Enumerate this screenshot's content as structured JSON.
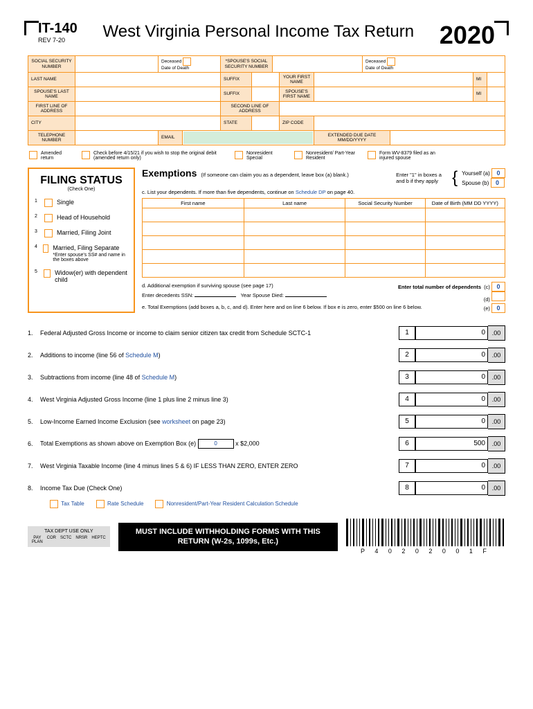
{
  "header": {
    "form_id": "IT-140",
    "rev": "REV 7-20",
    "title": "West Virginia Personal Income Tax Return",
    "year": "2020"
  },
  "grid": {
    "ssn": "SOCIAL SECURITY NUMBER",
    "deceased": "Deceased",
    "dod": "Date of Death",
    "spouse_ssn": "*SPOUSE'S SOCIAL SECURITY NUMBER",
    "last": "LAST NAME",
    "suffix": "SUFFIX",
    "first": "YOUR FIRST NAME",
    "mi": "MI",
    "spouse_last": "SPOUSE'S LAST NAME",
    "spouse_first": "SPOUSE'S FIRST NAME",
    "addr1": "FIRST LINE OF ADDRESS",
    "addr2": "SECOND LINE OF ADDRESS",
    "city": "CITY",
    "state": "STATE",
    "zip": "ZIP CODE",
    "phone": "TELEPHONE NUMBER",
    "email": "EMAIL",
    "ext_due": "EXTENDED DUE DATE MM/DD/YYYY"
  },
  "checks": {
    "amended": "Amended return",
    "stop_debit": "Check before 4/15/21 if you wish to stop the original debit (amended return only)",
    "nonres": "Nonresident Special",
    "partyear": "Nonresident/ Part-Year Resident",
    "wv8379": "Form WV-8379 filed as an injured spouse"
  },
  "filing": {
    "title": "FILING STATUS",
    "sub": "(Check One)",
    "opts": [
      "Single",
      "Head of Household",
      "Married, Filing Joint",
      "Married, Filing Separate",
      "Widow(er) with dependent child"
    ],
    "note": "*Enter spouse's SS# and name in the boxes above"
  },
  "exemptions": {
    "title": "Exemptions",
    "sub": "(If someone can claim you as a dependent, leave box (a) blank.)",
    "enter1": "Enter \"1\" in boxes a and b if they apply",
    "yourself": "Yourself (a)",
    "spouse": "Spouse (b)",
    "val_a": "0",
    "val_b": "0",
    "list": "c. List your dependents. If more than five dependents, continue on",
    "schedule_dp": "Schedule DP",
    "list2": "on page 40.",
    "cols": [
      "First name",
      "Last name",
      "Social Security Number",
      "Date of Birth (MM DD YYYY)"
    ],
    "d": "d. Additional exemption if surviving spouse (see page 17)",
    "d2": "Enter decedents SSN:",
    "d3": "Year Spouse Died:",
    "total_dep": "Enter total number of dependents",
    "val_c": "0",
    "val_d": "",
    "e": "e. Total Exemptions (add boxes a, b, c, and d). Enter here and on line 6 below. If box e is zero, enter $500 on line 6 below.",
    "val_e": "0"
  },
  "lines": [
    {
      "n": "1.",
      "t": "Federal Adjusted Gross Income or income to claim senior citizen tax credit from Schedule SCTC-1",
      "box": "1",
      "amt": "0"
    },
    {
      "n": "2.",
      "t": "Additions to income (line 56 of ",
      "link": "Schedule M",
      "t2": ")",
      "box": "2",
      "amt": "0"
    },
    {
      "n": "3.",
      "t": "Subtractions from income (line 48 of ",
      "link": "Schedule M",
      "t2": ")",
      "box": "3",
      "amt": "0"
    },
    {
      "n": "4.",
      "t": "West Virginia Adjusted Gross Income (line 1 plus line 2 minus line 3)",
      "box": "4",
      "amt": "0"
    },
    {
      "n": "5.",
      "t": "Low-Income Earned Income Exclusion (see ",
      "link": "worksheet",
      "t2": " on page 23)",
      "box": "5",
      "amt": "0"
    },
    {
      "n": "6.",
      "t": "Total Exemptions as shown above on Exemption Box (e) ",
      "inline": "0",
      "t2": " x $2,000 ",
      "box": "6",
      "amt": "500"
    },
    {
      "n": "7.",
      "t": "West Virginia Taxable Income (line 4 minus lines 5 & 6) IF LESS THAN ZERO, ENTER ZERO ",
      "box": "7",
      "amt": "0"
    },
    {
      "n": "8.",
      "t": "Income Tax Due (Check One) ",
      "box": "8",
      "amt": "0"
    }
  ],
  "line8_opts": [
    "Tax Table",
    "Rate Schedule",
    "Nonresident/Part-Year Resident Calculation Schedule"
  ],
  "footer": {
    "tax_dept": "TAX DEPT USE ONLY",
    "cols": [
      "PAY PLAN",
      "COR",
      "SCTC",
      "NRSR",
      "HEPTC"
    ],
    "must": "MUST INCLUDE WITHHOLDING FORMS WITH THIS RETURN (W-2s, 1099s, Etc.)",
    "barcode": "P 4 0 2 0 2 0 0 1 F"
  },
  "cents": ".00"
}
